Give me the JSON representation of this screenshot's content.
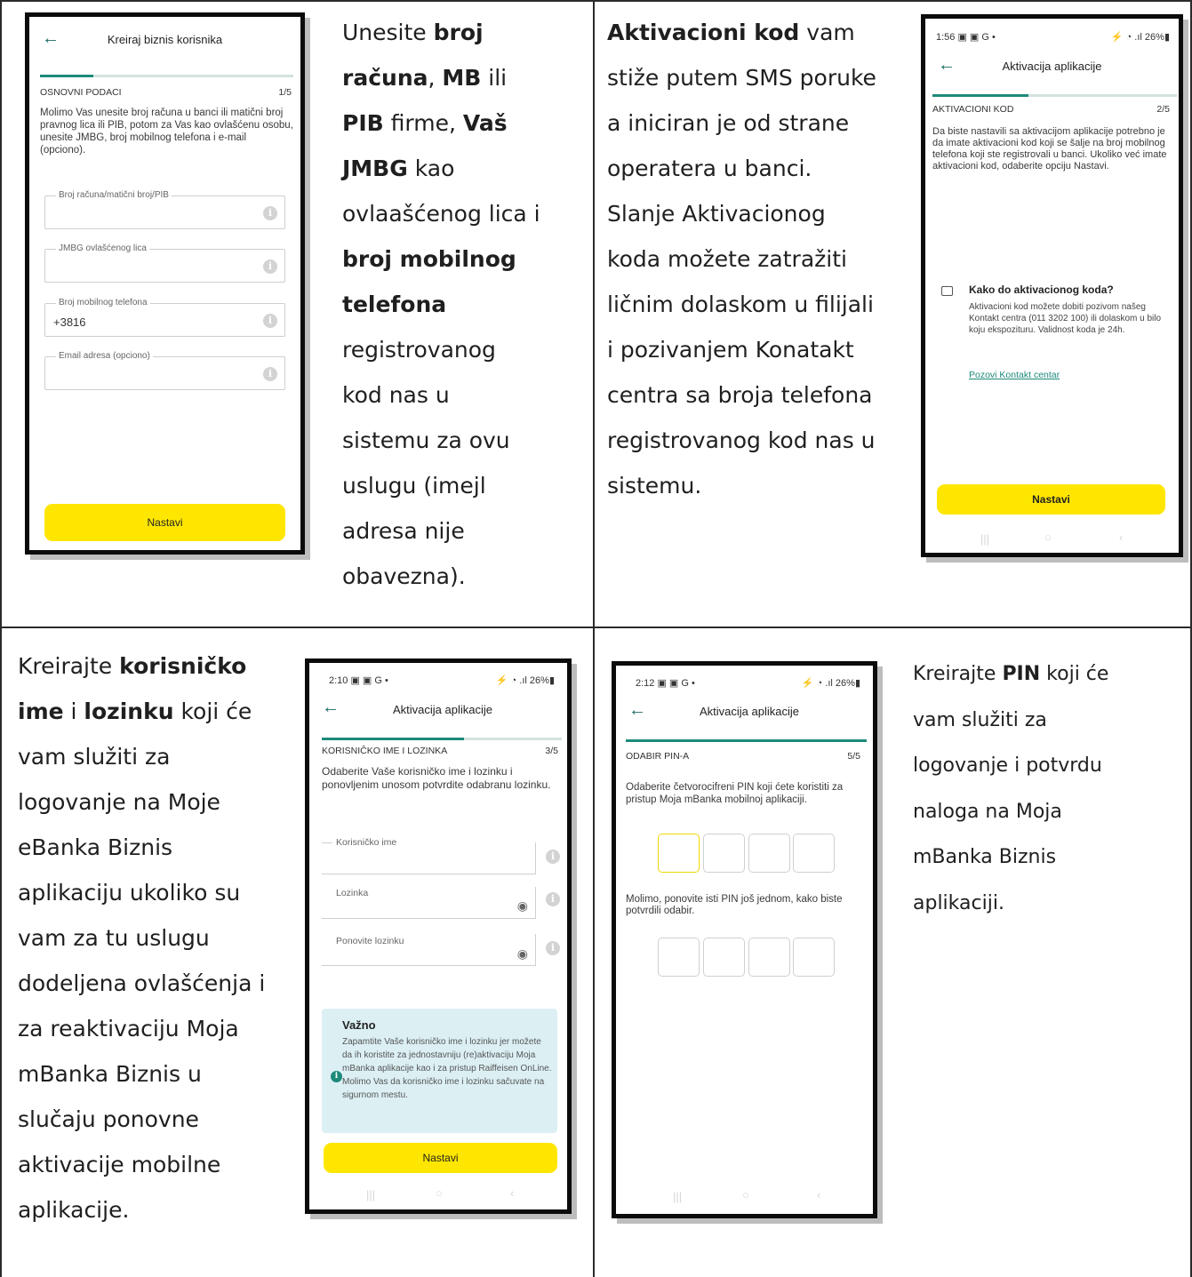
{
  "cell1": {
    "phone": {
      "title": "Kreiraj biznis korisnika",
      "section": "OSNOVNI PODACI",
      "step": "1/5",
      "body": "Molimo Vas unesite broj računa u banci ili matični broj pravnog lica ili PIB, potom za Vas kao ovlašćenu osobu, unesite JMBG, broj mobilnog telefona i e-mail (opciono).",
      "field_account": "Broj računa/matični broj/PIB",
      "field_jmbg": "JMBG ovlašćenog lica",
      "field_phone": "Broj mobilnog telefona",
      "field_phone_value": "+3816",
      "field_email": "Email adresa (opciono)",
      "button": "Nastavi"
    },
    "text": {
      "l1a": "Unesite ",
      "l1b": "broj",
      "l2a": "računa",
      "l2b": ", ",
      "l2c": "MB",
      "l2d": " ili",
      "l3a": "PIB",
      "l3b": " firme, ",
      "l3c": "Vaš",
      "l4a": "JMBG",
      "l4b": " kao",
      "l5": "ovlaašćenog lica i",
      "l6": "broj mobilnog",
      "l7": "telefona",
      "l8": "registrovanog",
      "l9": "kod nas u",
      "l10": "sistemu za ovu",
      "l11": "uslugu (imejl",
      "l12": "adresa nije",
      "l13": "obavezna)."
    }
  },
  "cell2": {
    "text": {
      "l1a": "Aktivacioni kod",
      "l1b": " vam",
      "l2": "stiže putem SMS poruke",
      "l3": "a iniciran je od strane",
      "l4": "operatera u banci.",
      "l5": "Slanje Aktivacionog",
      "l6": "koda možete zatražiti",
      "l7": "ličnim dolaskom u filijali",
      "l8": "i pozivanjem Konatakt",
      "l9": "centra sa broja telefona",
      "l10": "registrovanog kod nas u",
      "l11": "sistemu."
    },
    "phone": {
      "status_time": "1:56 ▣ ▣ G •",
      "status_right": "⚡ ◔ .ıl 26%▮",
      "title": "Aktivacija aplikacije",
      "section": "AKTIVACIONI KOD",
      "step": "2/5",
      "body": "Da biste nastavili sa aktivacijom aplikacije potrebno je da imate aktivacioni kod koji se šalje na broj mobilnog telefona koji ste registrovali u banci. Ukoliko već imate aktivacioni kod, odaberite opciju Nastavi.",
      "help_title": "Kako do aktivacionog koda?",
      "help_body": "Aktivacioni kod možete dobiti pozivom našeg Kontakt centra (011 3202 100) ili dolaskom u bilo koju ekspozituru. Validnost koda je 24h.",
      "help_link": "Pozovi Kontakt centar",
      "button": "Nastavi",
      "nav": [
        "|||",
        "○",
        "‹"
      ]
    }
  },
  "cell3": {
    "text": {
      "l1a": "Kreirajte ",
      "l1b": "korisničko",
      "l2a": "ime",
      "l2b": " i ",
      "l2c": "lozinku",
      "l2d": " koji će",
      "l3": "vam služiti za",
      "l4": "logovanje na Moje",
      "l5": "eBanka Biznis",
      "l6": "aplikaciju ukoliko su",
      "l7": "vam za tu uslugu",
      "l8": "dodeljena ovlašćenja i",
      "l9": "za reaktivaciju Moja",
      "l10": "mBanka Biznis u",
      "l11": "slučaju ponovne",
      "l12": "aktivacije mobilne",
      "l13": "aplikacije."
    },
    "phone": {
      "status_time": "2:10 ▣ ▣ G •",
      "status_right": "⚡ ◔ .ıl 26%▮",
      "title": "Aktivacija aplikacije",
      "section": "KORISNIČKO IME I LOZINKA",
      "step": "3/5",
      "body": "Odaberite Vaše korisničko ime i lozinku i ponovljenim unosom potvrdite odabranu lozinku.",
      "field_user": "Korisničko ime",
      "field_pass": "Lozinka",
      "field_pass2": "Ponovite lozinku",
      "note_title": "Važno",
      "note_body": "Zapamtite Vaše korisničko ime i lozinku jer možete da ih koristite za jednostavniju (re)aktivaciju Moja mBanka aplikacije kao i za pristup Raiffeisen OnLine. Molimo Vas da korisničko ime i lozinku sačuvate na sigurnom mestu.",
      "button": "Nastavi",
      "nav": [
        "|||",
        "○",
        "‹"
      ]
    }
  },
  "cell4": {
    "phone": {
      "status_time": "2:12 ▣ ▣ G •",
      "status_right": "⚡ ◔ .ıl 26%▮",
      "title": "Aktivacija aplikacije",
      "section": "ODABIR PIN-A",
      "step": "5/5",
      "body1": "Odaberite četvorocifreni PIN koji ćete koristiti za pristup Moja mBanka mobilnoj aplikaciji.",
      "body2": "Molimo, ponovite isti PIN još jednom, kako biste potvrdili odabir.",
      "nav": [
        "|||",
        "○",
        "‹"
      ]
    },
    "text": {
      "l1a": "Kreirajte ",
      "l1b": "PIN",
      "l1c": " koji će",
      "l2": "vam služiti za",
      "l3": "logovanje i potvrdu",
      "l4": "naloga na Moja",
      "l5": "mBanka Biznis",
      "l6": "aplikaciji."
    }
  }
}
